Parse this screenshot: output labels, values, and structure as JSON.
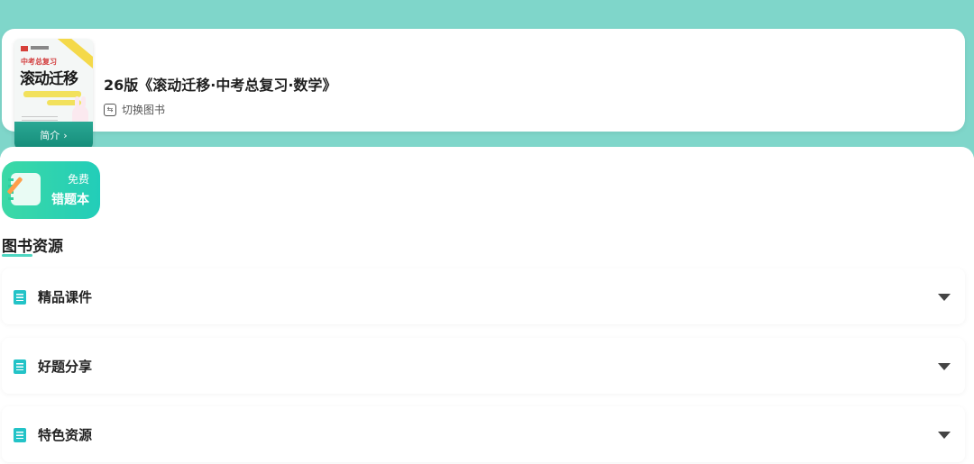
{
  "book": {
    "title": "26版《滚动迁移·中考总复习·数学》",
    "switch_label": "切换图书",
    "cover": {
      "small_title": "中考总复习",
      "big_title": "滚动迁移",
      "intro_label": "简介",
      "intro_chevron": "›"
    }
  },
  "wrong_book": {
    "badge": "免费",
    "label": "错题本",
    "icon": "notebook-pencil-icon"
  },
  "resources": {
    "title": "图书资源",
    "items": [
      {
        "label": "精品课件",
        "icon": "document-icon"
      },
      {
        "label": "好题分享",
        "icon": "document-icon"
      },
      {
        "label": "特色资源",
        "icon": "document-icon"
      }
    ]
  },
  "colors": {
    "header_bg": "#7fd6ca",
    "accent": "#23c3c7",
    "wrong_book_gradient": [
      "#3cd9a6",
      "#22cdb9"
    ]
  }
}
